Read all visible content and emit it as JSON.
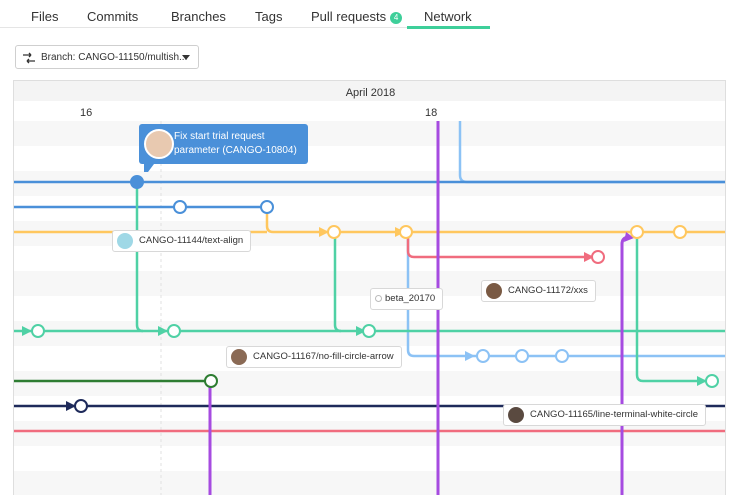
{
  "tabs": [
    {
      "label": "Files"
    },
    {
      "label": "Commits"
    },
    {
      "label": "Branches"
    },
    {
      "label": "Tags"
    },
    {
      "label": "Pull requests",
      "badge": "4"
    },
    {
      "label": "Network",
      "active": true
    }
  ],
  "branch_selector": {
    "label": "Branch: CANGO-11150/multish...",
    "icon": "branch-icon"
  },
  "graph": {
    "month": "April 2018",
    "days": [
      "16",
      "18"
    ],
    "commit_tooltip": "Fix start trial request parameter (CANGO-10804)",
    "branch_labels": [
      "CANGO-11144/text-align",
      "CANGO-11172/xxs",
      "CANGO-11167/no-fill-circle-arrow",
      "CANGO-11165/line-terminal-white-circle"
    ],
    "tag_label": "beta_20170"
  },
  "colors": {
    "accent": "#3ecf9a",
    "blue": "#4a90d9",
    "light_blue": "#8cc2f5",
    "orange": "#ffc75e",
    "red": "#f06c7e",
    "green": "#4fd1a5",
    "purple": "#a64be0",
    "dark_green": "#2e7d32",
    "navy": "#1e2a5a"
  }
}
